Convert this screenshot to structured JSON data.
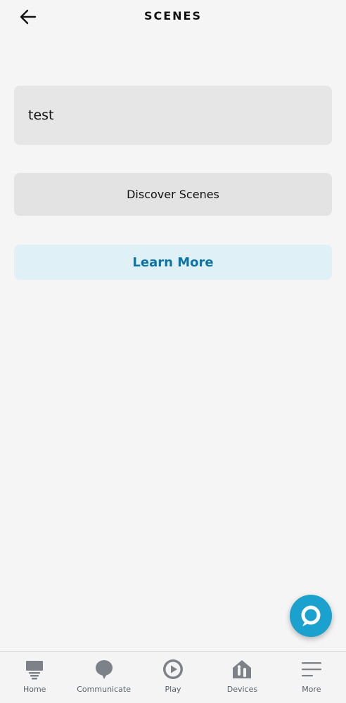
{
  "header": {
    "title": "SCENES",
    "back_icon": "arrow-left-icon"
  },
  "scenes": [
    {
      "name": "test"
    }
  ],
  "actions": {
    "discover_label": "Discover Scenes",
    "learn_more_label": "Learn More"
  },
  "alexa": {
    "icon": "alexa-ring-icon"
  },
  "bottom_nav": {
    "items": [
      {
        "label": "Home",
        "icon": "home-icon"
      },
      {
        "label": "Communicate",
        "icon": "chat-bubble-icon"
      },
      {
        "label": "Play",
        "icon": "play-icon"
      },
      {
        "label": "Devices",
        "icon": "devices-icon"
      },
      {
        "label": "More",
        "icon": "menu-icon"
      }
    ]
  },
  "colors": {
    "background": "#f5f5f5",
    "card": "#e6e6e7",
    "learn_more_bg": "#dff1f7",
    "learn_more_text": "#0c75a6",
    "alexa_blue": "#1aa1ce",
    "nav_icon": "#7d8288"
  }
}
